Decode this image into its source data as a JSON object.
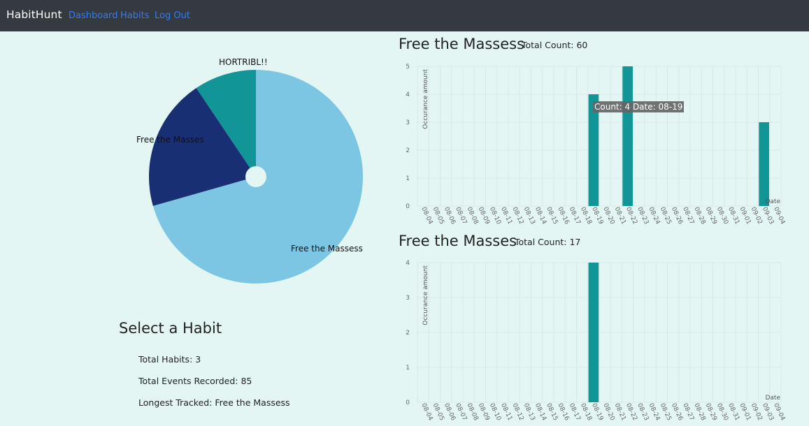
{
  "nav": {
    "brand": "HabitHunt",
    "links": [
      "Dashboard",
      "Habits",
      "Log Out"
    ]
  },
  "pie": {
    "slices": [
      {
        "label": "Free the Massess",
        "value": 60,
        "color": "#7cc6e3"
      },
      {
        "label": "Free the Masses",
        "value": 17,
        "color": "#182f74"
      },
      {
        "label": "HORTRIBL!!",
        "value": 8,
        "color": "#129596"
      }
    ]
  },
  "select": {
    "title": "Select a Habit",
    "total_habits": "Total Habits: 3",
    "total_events": "Total Events Recorded: 85",
    "longest": "Longest Tracked: Free the Massess"
  },
  "charts": [
    {
      "title": "Free the Massess",
      "count_text": "Total Count: 60",
      "tooltip": "Count: 4 Date: 08-19"
    },
    {
      "title": "Free the Masses",
      "count_text": "Total Count: 17"
    }
  ],
  "chart_data": [
    {
      "type": "bar",
      "title": "Free the Massess",
      "ylabel": "Occurance amount",
      "xlabel": "Date",
      "ylim": [
        0,
        5
      ],
      "categories": [
        "08-04",
        "08-05",
        "08-06",
        "08-07",
        "08-08",
        "08-09",
        "08-10",
        "08-11",
        "08-12",
        "08-13",
        "08-14",
        "08-15",
        "08-16",
        "08-17",
        "08-18",
        "08-19",
        "08-20",
        "08-21",
        "08-22",
        "08-23",
        "08-24",
        "08-25",
        "08-26",
        "08-27",
        "08-28",
        "08-29",
        "08-30",
        "08-31",
        "09-01",
        "09-02",
        "09-03",
        "09-04"
      ],
      "values": [
        0,
        0,
        0,
        0,
        0,
        0,
        0,
        0,
        0,
        0,
        0,
        0,
        0,
        0,
        0,
        4,
        0,
        0,
        5,
        0,
        0,
        0,
        0,
        0,
        0,
        0,
        0,
        0,
        0,
        0,
        3,
        0
      ],
      "color": "#129596"
    },
    {
      "type": "bar",
      "title": "Free the Masses",
      "ylabel": "Occurance amount",
      "xlabel": "Date",
      "ylim": [
        0,
        4
      ],
      "categories": [
        "08-04",
        "08-05",
        "08-06",
        "08-07",
        "08-08",
        "08-09",
        "08-10",
        "08-11",
        "08-12",
        "08-13",
        "08-14",
        "08-15",
        "08-16",
        "08-17",
        "08-18",
        "08-19",
        "08-20",
        "08-21",
        "08-22",
        "08-23",
        "08-24",
        "08-25",
        "08-26",
        "08-27",
        "08-28",
        "08-29",
        "08-30",
        "08-31",
        "09-01",
        "09-02",
        "09-03",
        "09-04"
      ],
      "values": [
        0,
        0,
        0,
        0,
        0,
        0,
        0,
        0,
        0,
        0,
        0,
        0,
        0,
        0,
        0,
        4,
        0,
        0,
        0,
        0,
        0,
        0,
        0,
        0,
        0,
        0,
        0,
        0,
        0,
        0,
        0,
        0
      ],
      "color": "#129596"
    }
  ]
}
